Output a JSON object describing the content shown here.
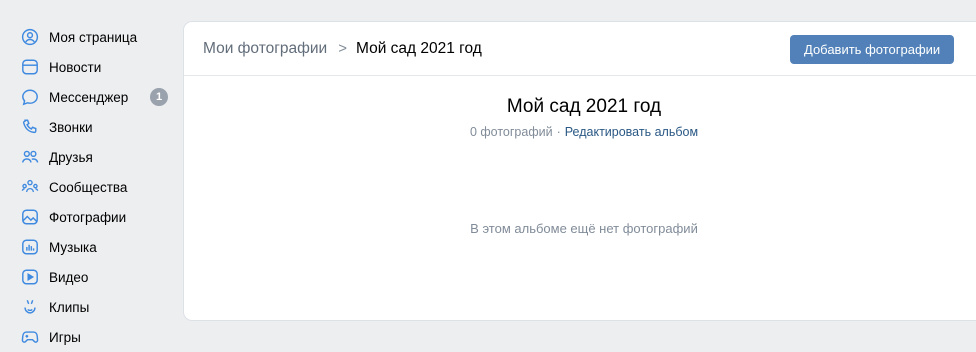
{
  "sidebar": {
    "items": [
      {
        "label": "Моя страница",
        "icon": "user-circle-icon"
      },
      {
        "label": "Новости",
        "icon": "news-icon"
      },
      {
        "label": "Мессенджер",
        "icon": "message-icon",
        "badge": "1"
      },
      {
        "label": "Звонки",
        "icon": "phone-icon"
      },
      {
        "label": "Друзья",
        "icon": "friends-icon"
      },
      {
        "label": "Сообщества",
        "icon": "communities-icon"
      },
      {
        "label": "Фотографии",
        "icon": "photo-icon"
      },
      {
        "label": "Музыка",
        "icon": "music-icon"
      },
      {
        "label": "Видео",
        "icon": "video-icon"
      },
      {
        "label": "Клипы",
        "icon": "clips-icon"
      },
      {
        "label": "Игры",
        "icon": "gamepad-icon"
      }
    ]
  },
  "header": {
    "breadcrumb_parent": "Мои фотографии",
    "breadcrumb_separator": ">",
    "breadcrumb_current": "Мой сад 2021 год",
    "add_button_label": "Добавить фотографии"
  },
  "album": {
    "title": "Мой сад 2021 год",
    "photo_count": "0 фотографий",
    "meta_separator": "·",
    "edit_link": "Редактировать альбом",
    "empty_message": "В этом альбоме ещё нет фотографий"
  },
  "colors": {
    "accent": "#5181b8",
    "icon": "#3f8ae0",
    "link": "#2a5885",
    "background": "#edeef0",
    "badge": "#99a2ad"
  }
}
